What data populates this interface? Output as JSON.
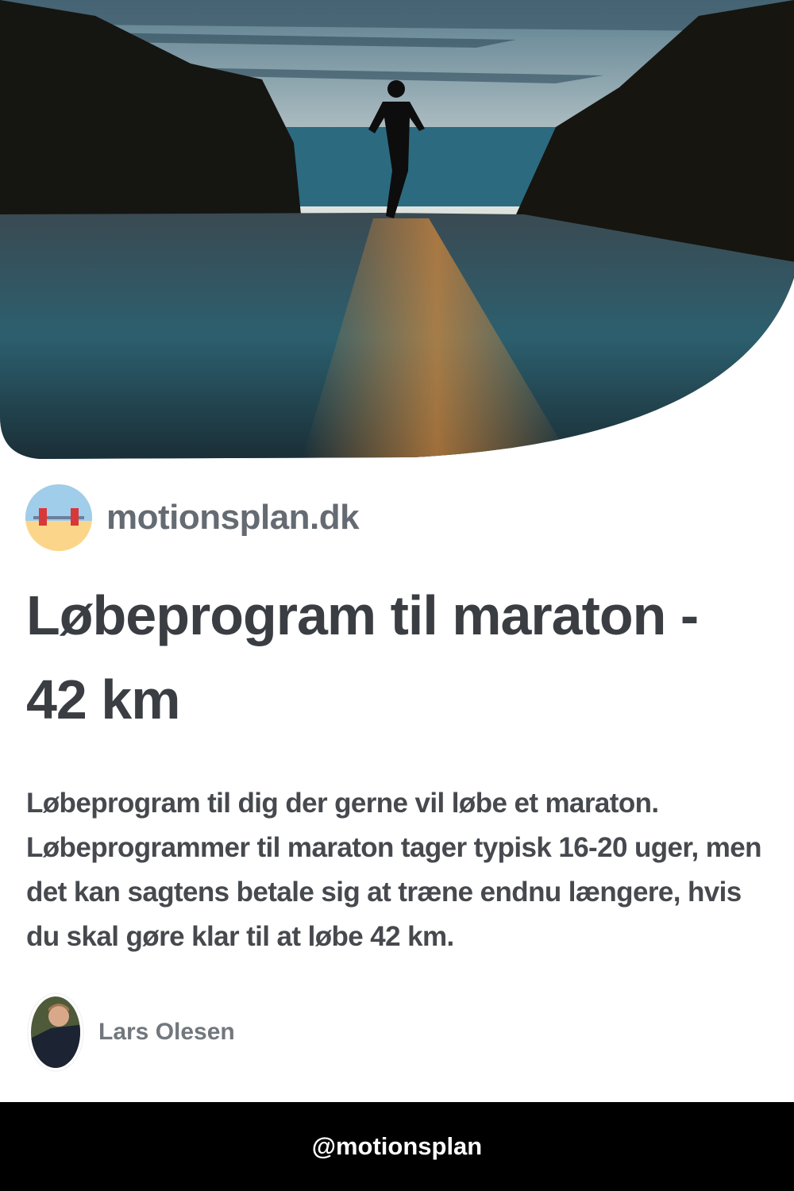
{
  "hero": {
    "image": "runner-on-wet-road-at-sunset"
  },
  "site": {
    "logo_icon": "barbell-on-beach-icon",
    "name": "motionsplan.dk"
  },
  "article": {
    "title": "Løbeprogram til maraton - 42 km",
    "description": "Løbeprogram til dig der gerne vil løbe et maraton. Løbeprogrammer til maraton tager typisk 16-20 uger, men det kan sagtens betale sig at træne endnu længere, hvis du skal gøre klar til at løbe 42 km."
  },
  "author": {
    "name": "Lars Olesen"
  },
  "footer": {
    "handle": "@motionsplan"
  }
}
